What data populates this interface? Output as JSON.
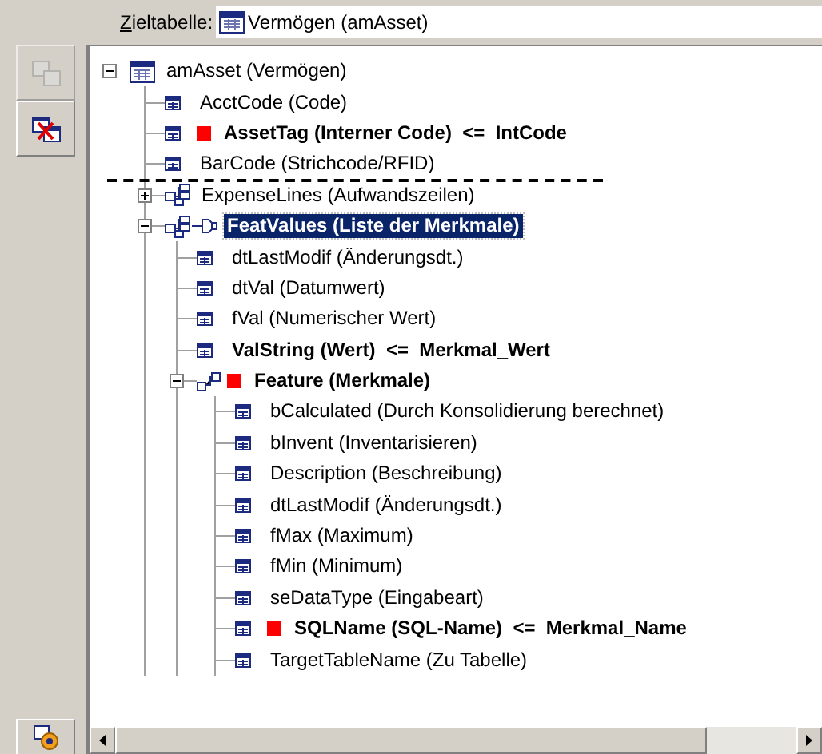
{
  "target_table": {
    "label": "Zieltabelle:",
    "value": "Vermögen (amAsset)"
  },
  "toolbar": [
    {
      "kind": "copy",
      "disabled": true
    },
    {
      "kind": "delete",
      "disabled": false
    }
  ],
  "tree": {
    "label": "amAsset (Vermögen)",
    "kind": "table",
    "expanded": true,
    "selected": false,
    "bold": false,
    "marked": false,
    "children": [
      {
        "kind": "field",
        "label": "AcctCode (Code)",
        "bold": false,
        "marked": false,
        "selected": false
      },
      {
        "kind": "field",
        "label": "AssetTag (Interner Code)  <=  IntCode",
        "bold": true,
        "marked": true,
        "selected": false
      },
      {
        "kind": "field",
        "label": "BarCode (Strichcode/RFID)",
        "bold": false,
        "marked": false,
        "selected": false
      },
      {
        "kind": "separator"
      },
      {
        "kind": "link",
        "label": "ExpenseLines (Aufwandszeilen)",
        "bold": false,
        "marked": false,
        "selected": false,
        "expanded": false
      },
      {
        "kind": "link",
        "label": "FeatValues (Liste der Merkmale)",
        "bold": true,
        "marked": false,
        "selected": true,
        "expanded": true,
        "pinned": true,
        "children": [
          {
            "kind": "field",
            "label": "dtLastModif (Änderungsdt.)",
            "bold": false,
            "marked": false,
            "selected": false
          },
          {
            "kind": "field",
            "label": "dtVal (Datumwert)",
            "bold": false,
            "marked": false,
            "selected": false
          },
          {
            "kind": "field",
            "label": "fVal (Numerischer Wert)",
            "bold": false,
            "marked": false,
            "selected": false
          },
          {
            "kind": "field",
            "label": "ValString (Wert)  <=  Merkmal_Wert",
            "bold": true,
            "marked": false,
            "selected": false
          },
          {
            "kind": "relation",
            "label": "Feature (Merkmale)",
            "bold": true,
            "marked": true,
            "selected": false,
            "expanded": true,
            "children": [
              {
                "kind": "field",
                "label": "bCalculated (Durch Konsolidierung berechnet)",
                "bold": false,
                "marked": false,
                "selected": false
              },
              {
                "kind": "field",
                "label": "bInvent (Inventarisieren)",
                "bold": false,
                "marked": false,
                "selected": false
              },
              {
                "kind": "field",
                "label": "Description (Beschreibung)",
                "bold": false,
                "marked": false,
                "selected": false
              },
              {
                "kind": "field",
                "label": "dtLastModif (Änderungsdt.)",
                "bold": false,
                "marked": false,
                "selected": false
              },
              {
                "kind": "field",
                "label": "fMax (Maximum)",
                "bold": false,
                "marked": false,
                "selected": false
              },
              {
                "kind": "field",
                "label": "fMin (Minimum)",
                "bold": false,
                "marked": false,
                "selected": false
              },
              {
                "kind": "field",
                "label": "seDataType (Eingabeart)",
                "bold": false,
                "marked": false,
                "selected": false
              },
              {
                "kind": "field",
                "label": "SQLName (SQL-Name)  <=  Merkmal_Name",
                "bold": true,
                "marked": true,
                "selected": false
              },
              {
                "kind": "field",
                "label": "TargetTableName (Zu Tabelle)",
                "bold": false,
                "marked": false,
                "selected": false
              }
            ]
          }
        ]
      }
    ]
  }
}
